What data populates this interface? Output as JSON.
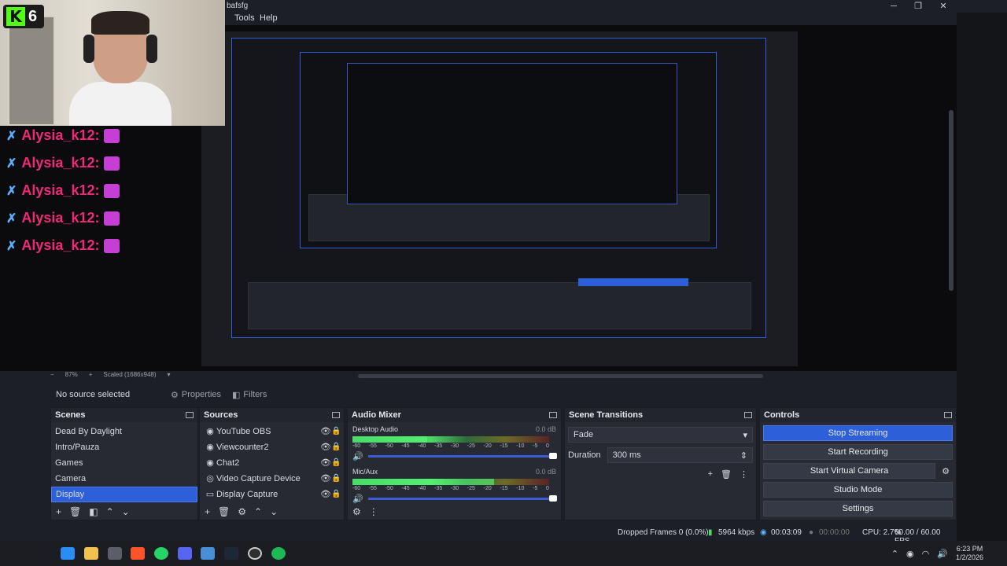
{
  "window": {
    "title": "bafsfg",
    "minimize": "─",
    "maximize": "❐",
    "close": "✕"
  },
  "menu": [
    "Tools",
    "Help"
  ],
  "overlay": {
    "badge_letter": "K",
    "badge_count": "6",
    "chat": [
      "Alysia_k12:",
      "Alysia_k12:",
      "Alysia_k12:",
      "Alysia_k12:",
      "Alysia_k12:"
    ]
  },
  "preview_footer": {
    "zoom": "87%",
    "scaled": "Scaled (1686x948)"
  },
  "source_bar": {
    "no_source": "No source selected",
    "properties": "Properties",
    "filters": "Filters"
  },
  "scenes": {
    "title": "Scenes",
    "items": [
      "Dead By Daylight",
      "Intro/Pauza",
      "Games",
      "Camera",
      "Display"
    ],
    "selected": "Display"
  },
  "sources": {
    "title": "Sources",
    "items": [
      {
        "icon": "◉",
        "name": "YouTube OBS"
      },
      {
        "icon": "◉",
        "name": "Viewcounter2"
      },
      {
        "icon": "◉",
        "name": "Chat2"
      },
      {
        "icon": "◎",
        "name": "Video Capture Device"
      },
      {
        "icon": "▭",
        "name": "Display Capture"
      }
    ]
  },
  "mixer": {
    "title": "Audio Mixer",
    "channels": [
      {
        "name": "Desktop Audio",
        "db": "0.0 dB",
        "level": 0.38
      },
      {
        "name": "Mic/Aux",
        "db": "0.0 dB",
        "level": 0.72
      }
    ],
    "ticks": [
      "-60",
      "-55",
      "-50",
      "-45",
      "-40",
      "-35",
      "-30",
      "-25",
      "-20",
      "-15",
      "-10",
      "-5",
      "0"
    ]
  },
  "transitions": {
    "title": "Scene Transitions",
    "type": "Fade",
    "duration_label": "Duration",
    "duration": "300 ms"
  },
  "controls": {
    "title": "Controls",
    "buttons": [
      "Stop Streaming",
      "Start Recording",
      "Start Virtual Camera",
      "Studio Mode",
      "Settings"
    ]
  },
  "status": {
    "dropped": "Dropped Frames 0 (0.0%)",
    "bitrate": "5964 kbps",
    "stream_time": "00:03:09",
    "rec_time": "00:00:00",
    "cpu": "CPU: 2.7%",
    "fps": "60.00 / 60.00 FPS"
  },
  "taskbar": {
    "time": "6:23 PM",
    "date": "1/2/2026"
  },
  "colors": {
    "accent": "#2d5fd8",
    "chat_name": "#ec2a78",
    "kick_green": "#53fc18"
  }
}
